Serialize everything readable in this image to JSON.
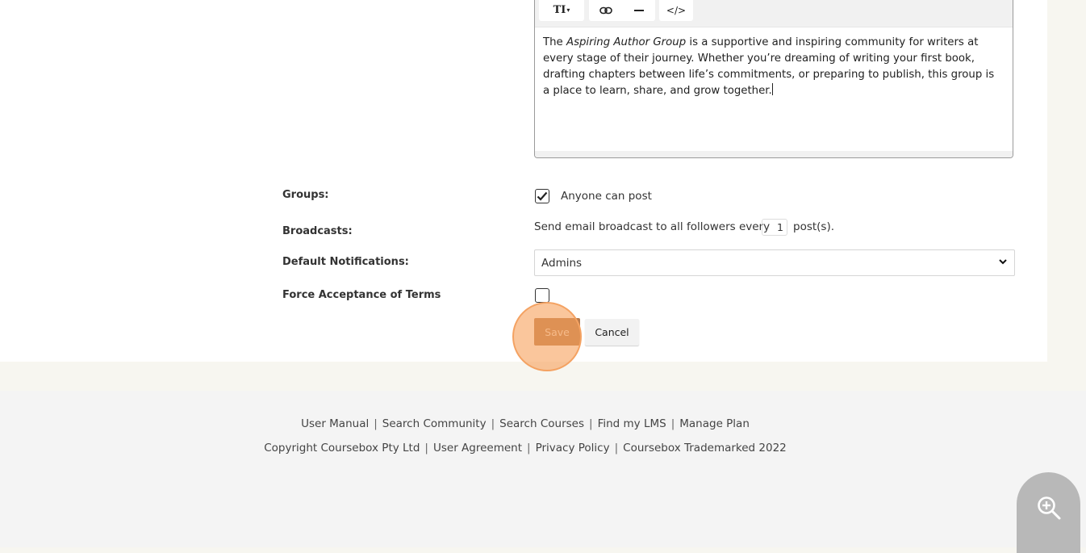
{
  "editor": {
    "toolbar": {
      "text_style_label": "TI",
      "link_icon": "link-icon",
      "hr_icon": "horizontal-rule-icon",
      "code_label": "</>"
    },
    "content": {
      "prefix": "The ",
      "emphasis": "Aspiring Author Group",
      "body": " is a supportive and inspiring community for writers at every stage of their journey. Whether you’re dreaming of writing your first book, drafting chapters between life’s commitments, or preparing to publish, this group is a place to learn, share, and grow together."
    }
  },
  "form": {
    "groups": {
      "label": "Groups:",
      "checkbox_checked": true,
      "option_label": "Anyone can post"
    },
    "broadcasts": {
      "label": "Broadcasts:",
      "text_before": "Send email broadcast to all followers every",
      "value": "1",
      "text_after": "post(s)."
    },
    "notifications": {
      "label": "Default Notifications:",
      "selected": "Admins"
    },
    "terms": {
      "label": "Force Acceptance of Terms",
      "checkbox_checked": false
    },
    "save_label": "Save",
    "cancel_label": "Cancel"
  },
  "footer": {
    "row1": [
      "User Manual",
      "Search Community",
      "Search Courses",
      "Find my LMS",
      "Manage Plan"
    ],
    "row2": [
      "Copyright Coursebox Pty Ltd",
      "User Agreement",
      "Privacy Policy",
      "Coursebox Trademarked 2022"
    ],
    "separator": "|"
  },
  "zoom_icon": "zoom-in-icon",
  "colors": {
    "save_bg": "#b87a4b",
    "highlight": "#f7a05a",
    "page_bg": "#f7f6f0",
    "footer_bg": "#f4f4f4"
  }
}
